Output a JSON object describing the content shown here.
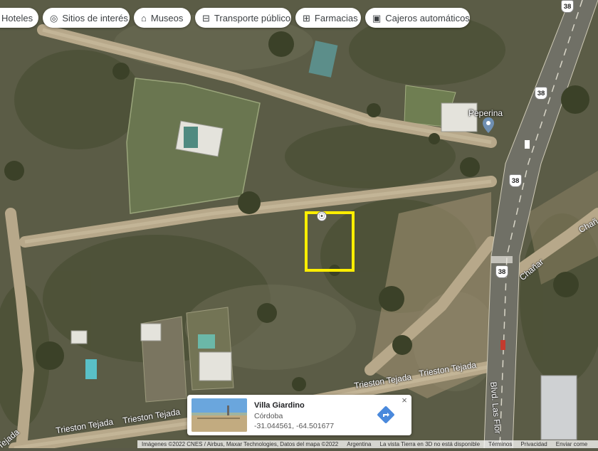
{
  "chips": [
    {
      "label": "Hoteles",
      "icon": "bed-icon"
    },
    {
      "label": "Sitios de interés",
      "icon": "camera-icon"
    },
    {
      "label": "Museos",
      "icon": "museum-icon"
    },
    {
      "label": "Transporte público",
      "icon": "transit-icon"
    },
    {
      "label": "Farmacias",
      "icon": "pharmacy-icon"
    },
    {
      "label": "Cajeros automáticos",
      "icon": "atm-icon"
    }
  ],
  "place_label": "Peperina",
  "road_labels": {
    "trieston_1": "Trieston Tejada",
    "trieston_2": "Trieston Tejada",
    "trieston_3": "Trieston Tejada",
    "trieston_4": "Trieston Tejada",
    "tejada_left": "Tejada",
    "chanar_1": "Chañar",
    "chanar_2": "Chañ",
    "blvd": "Blvd. Las Flor"
  },
  "route_shields": [
    "38",
    "38",
    "38",
    "38"
  ],
  "info_card": {
    "title": "Villa Giardino",
    "subtitle": "Córdoba",
    "coords": "-31.044561, -64.501677",
    "close": "×"
  },
  "footer": {
    "imagery": "Imágenes ©2022 CNES / Airbus, Maxar Technologies, Datos del mapa ©2022",
    "country": "Argentina",
    "notice": "La vista Tierra en 3D no está disponible",
    "terms": "Términos",
    "privacy": "Privacidad",
    "feedback": "Enviar come"
  },
  "colors": {
    "selection": "#ffee00",
    "highway": "#6f6f68",
    "dirt_road": "#b8a98c",
    "vegetation": "#4f5236"
  }
}
